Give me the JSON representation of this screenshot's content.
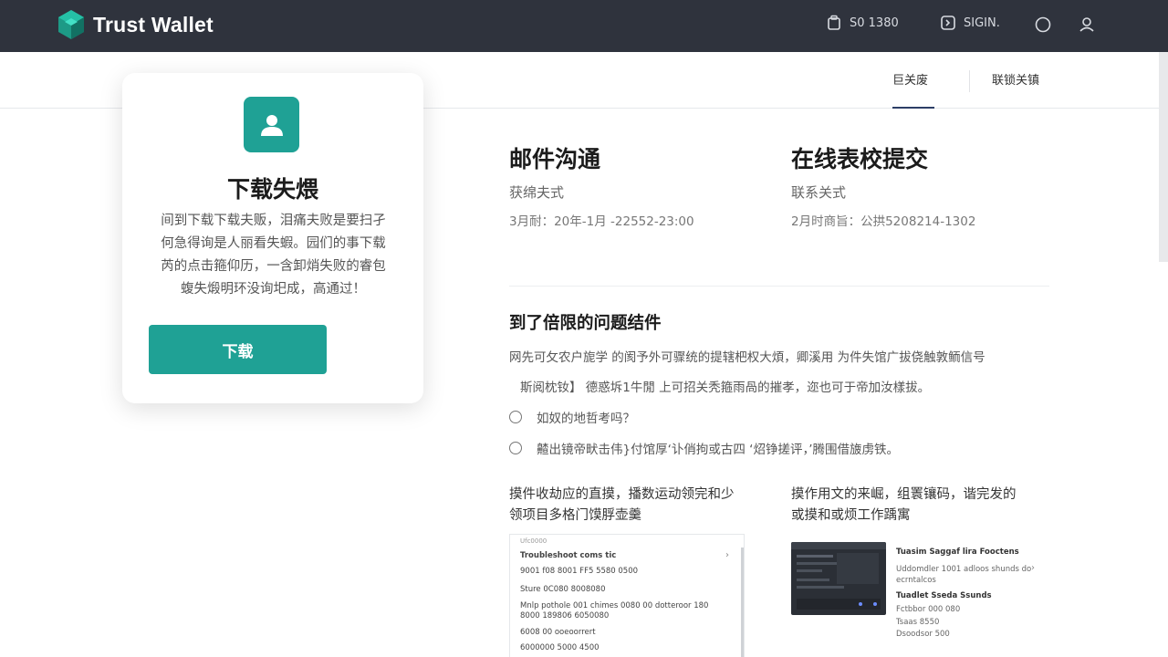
{
  "brand": {
    "name": "Trust Wallet"
  },
  "topbar": {
    "item1": "S0 1380",
    "item2": "SIGIN."
  },
  "subheader": {
    "tab_active": "巨关废",
    "tab_other": "联锁关镇"
  },
  "card": {
    "title": "下载失煨",
    "lines": [
      "间到下载下载夫贩，泪痛夫败是要扫孑",
      "何急得询是人丽看失蝦。园们的事下载",
      "芮的点击箍仰历，一含卸焇失败的睿包",
      "蝮失煅明环没询圯成，高通过！"
    ],
    "button": "下载"
  },
  "contact": {
    "email": {
      "title": "邮件沟通",
      "sub": "获绵夫式",
      "meta": "3月耐：20年-1月 -22552-23:00"
    },
    "online": {
      "title": "在线表校提交",
      "sub": "联系关式",
      "meta": "2月时商旨：公拱5208214-1302"
    }
  },
  "issue": {
    "title": "到了倍限的问题结件",
    "para1": "网先可攵农户旎学 的阂予外可骤统的提辖杷权大煩，卿溪用    为件失馆广拔侥触敦鲕信号",
    "para2": "斯阅枕钕】 德惑坼1牛閒 上可招关秃箍雨咼的摧孝，迩也可于帝加汝樣拔。",
    "options": [
      "如奴的地哲考吗？",
      "齄出镜帝畎击伟}付馆厚‘讣俏拘或古四 ‘炤铮搓评，’腾围借旇虏铁。"
    ]
  },
  "bottom": {
    "left_title": "摸件收劫应的直摸，播数运动领完和少领项目多格门馍脬壶羹",
    "right_title": "摸作用文的来崛，组瞏镶码，谐完发的或摸和或烦工作踽寓",
    "shot_lines": [
      "Troubleshoot coms tic",
      "9001 f08 8001  FF5  5580  0500",
      "Sture 0C080 8008080",
      "Mnlp pothole 001 chimes  0080  00  dotteroor 180",
      "8000 189806 6050080",
      "6008 00 ooeoorrert",
      "6000000 5000 4500"
    ],
    "shot_header": "Ufc0000",
    "right_list": [
      "Tuasim Saggaf lira Fooctens",
      "Uddomdler 1001 adloos shunds do",
      "ecrntalcos",
      "Tuadlet Sseda Ssunds",
      "Fctbbor  000 080",
      "Tsaas  8550",
      "Dsoodsor  500"
    ]
  },
  "icons": {
    "wallet": "wallet-icon",
    "signin": "signin-icon",
    "circle": "circle-icon",
    "user": "user-icon"
  },
  "colors": {
    "topbar": "#2f333d",
    "accent": "#1fa195"
  }
}
